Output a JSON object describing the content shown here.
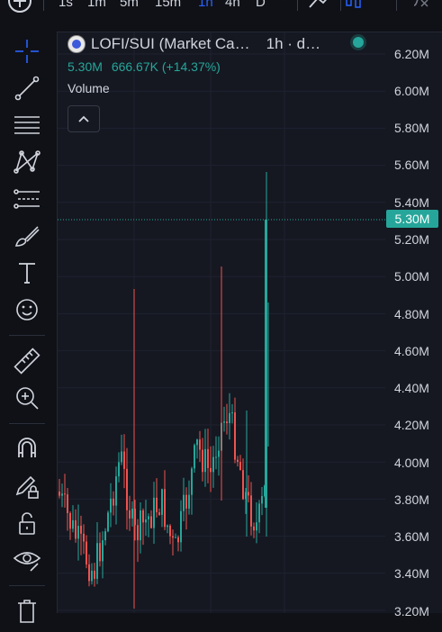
{
  "toolbar": {
    "timeframes": [
      "1s",
      "1m",
      "5m",
      "15m",
      "1h",
      "4h",
      "D"
    ],
    "active_timeframe": "1h"
  },
  "legend": {
    "title": "LOFI/SUI (Market Ca…",
    "timeframe": "1h · d…",
    "value": "5.30M",
    "change": "666.67K (+14.37%)",
    "indicator": "Volume"
  },
  "price_axis": {
    "ticks": [
      "6.20M",
      "6.00M",
      "5.80M",
      "5.60M",
      "5.40M",
      "5.20M",
      "5.00M",
      "4.80M",
      "4.60M",
      "4.40M",
      "4.20M",
      "4.00M",
      "3.80M",
      "3.60M",
      "3.40M",
      "3.20M"
    ],
    "current_price": "5.30M"
  },
  "sidebar": {
    "tools": [
      "crosshair-icon",
      "trend-line-icon",
      "horizontal-lines-icon",
      "pattern-icon",
      "fib-icon",
      "brush-icon",
      "text-icon",
      "emoji-icon",
      "ruler-icon",
      "zoom-in-icon",
      "magnet-icon",
      "lock-drawing-icon",
      "unlock-icon",
      "eye-icon",
      "trash-icon"
    ]
  },
  "colors": {
    "up": "#26a69a",
    "down": "#ef5350",
    "active": "#2962ff",
    "background": "#151821"
  }
}
